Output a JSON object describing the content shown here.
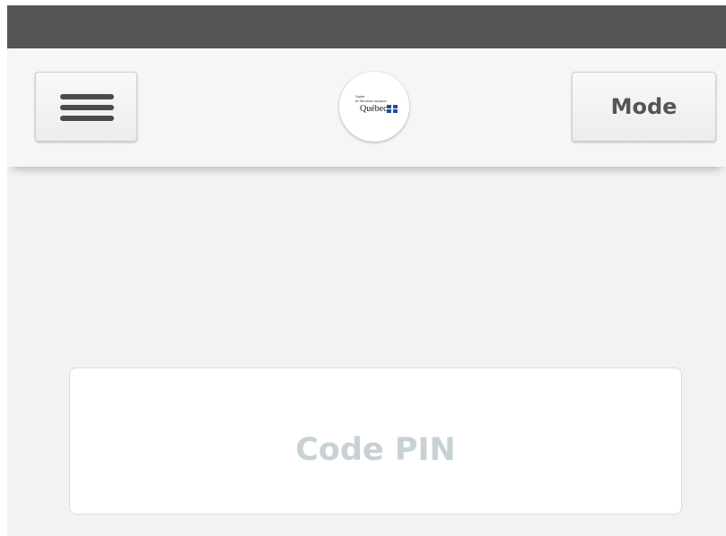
{
  "header": {
    "menu_icon": "hamburger-icon",
    "mode_label": "Mode",
    "logo": {
      "line1": "Santé",
      "line2": "et Services sociaux",
      "name": "Québec"
    }
  },
  "pin": {
    "placeholder": "Code PIN"
  },
  "colors": {
    "status_bar": "#555555",
    "background": "#f2f2f2",
    "placeholder": "#c8d1d6"
  }
}
